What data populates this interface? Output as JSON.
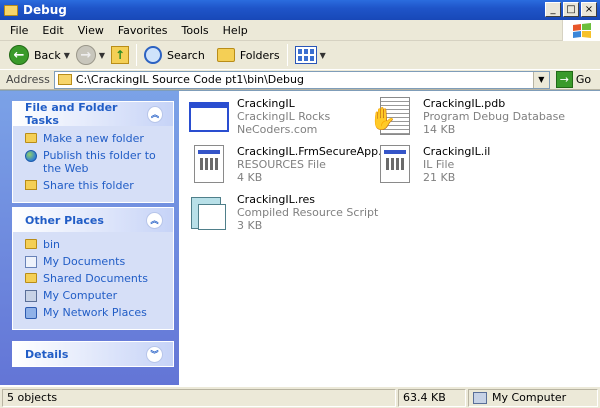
{
  "window": {
    "title": "Debug"
  },
  "menu": [
    "File",
    "Edit",
    "View",
    "Favorites",
    "Tools",
    "Help"
  ],
  "toolbar": {
    "back": "Back",
    "search": "Search",
    "folders": "Folders"
  },
  "address": {
    "label": "Address",
    "value": "C:\\CrackingIL Source Code pt1\\bin\\Debug",
    "go": "Go"
  },
  "tasks": {
    "file_folder": {
      "title": "File and Folder Tasks",
      "items": [
        "Make a new folder",
        "Publish this folder to the Web",
        "Share this folder"
      ]
    },
    "other_places": {
      "title": "Other Places",
      "items": [
        "bin",
        "My Documents",
        "Shared Documents",
        "My Computer",
        "My Network Places"
      ]
    },
    "details": {
      "title": "Details"
    }
  },
  "files": [
    {
      "name": "CrackingIL",
      "line2": "CrackingIL Rocks",
      "line3": "NeCoders.com",
      "icon": "application-window-icon"
    },
    {
      "name": "CrackingIL.pdb",
      "line2": "Program Debug Database",
      "line3": "14 KB",
      "icon": "pdb-file-icon"
    },
    {
      "name": "CrackingIL.FrmSecureApp.res...",
      "line2": "RESOURCES File",
      "line3": "4 KB",
      "icon": "resources-file-icon"
    },
    {
      "name": "CrackingIL.il",
      "line2": "IL File",
      "line3": "21 KB",
      "icon": "il-file-icon"
    },
    {
      "name": "CrackingIL.res",
      "line2": "Compiled Resource Script",
      "line3": "3 KB",
      "icon": "res-file-icon"
    }
  ],
  "status": {
    "objects": "5 objects",
    "size": "63.4 KB",
    "location": "My Computer"
  }
}
